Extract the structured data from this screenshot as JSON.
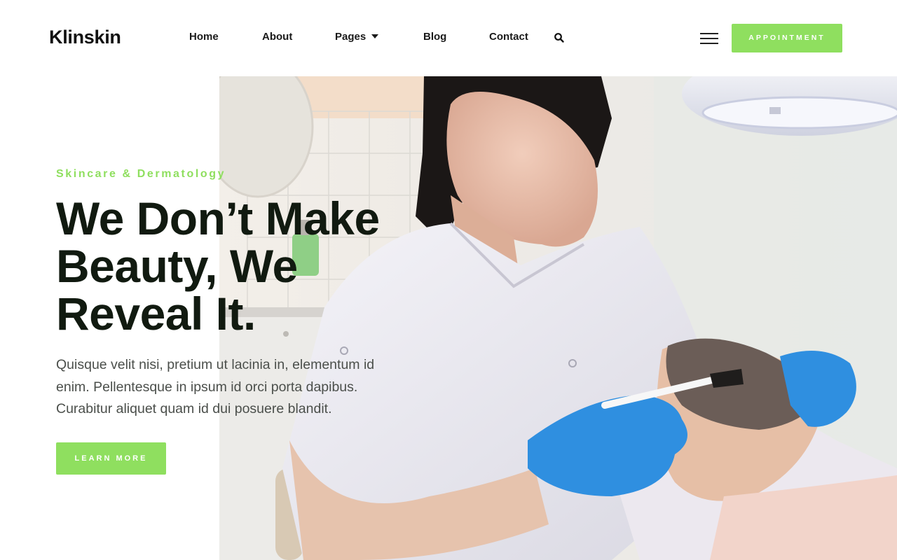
{
  "header": {
    "logo": "Klinskin",
    "nav": [
      {
        "label": "Home"
      },
      {
        "label": "About"
      },
      {
        "label": "Pages",
        "has_dropdown": true
      },
      {
        "label": "Blog"
      },
      {
        "label": "Contact"
      }
    ],
    "search_icon": "search-icon",
    "menu_icon": "hamburger-menu-icon",
    "cta_label": "APPOINTMENT"
  },
  "hero": {
    "eyebrow": "Skincare & Dermatology",
    "headline_lines": [
      "We Don’t Make",
      "Beauty, We",
      "Reveal It."
    ],
    "lead_lines": [
      "Quisque velit nisi, pretium ut lacinia in, elementum id",
      "enim. Pellentesque in ipsum id orci porta dapibus.",
      "Curabitur aliquet quam id dui posuere blandit."
    ],
    "button_label": "LEARN MORE"
  },
  "colors": {
    "accent": "#8fdf5f",
    "heading": "#111a10",
    "body_text": "#4b4f4b",
    "background": "#ffffff"
  }
}
